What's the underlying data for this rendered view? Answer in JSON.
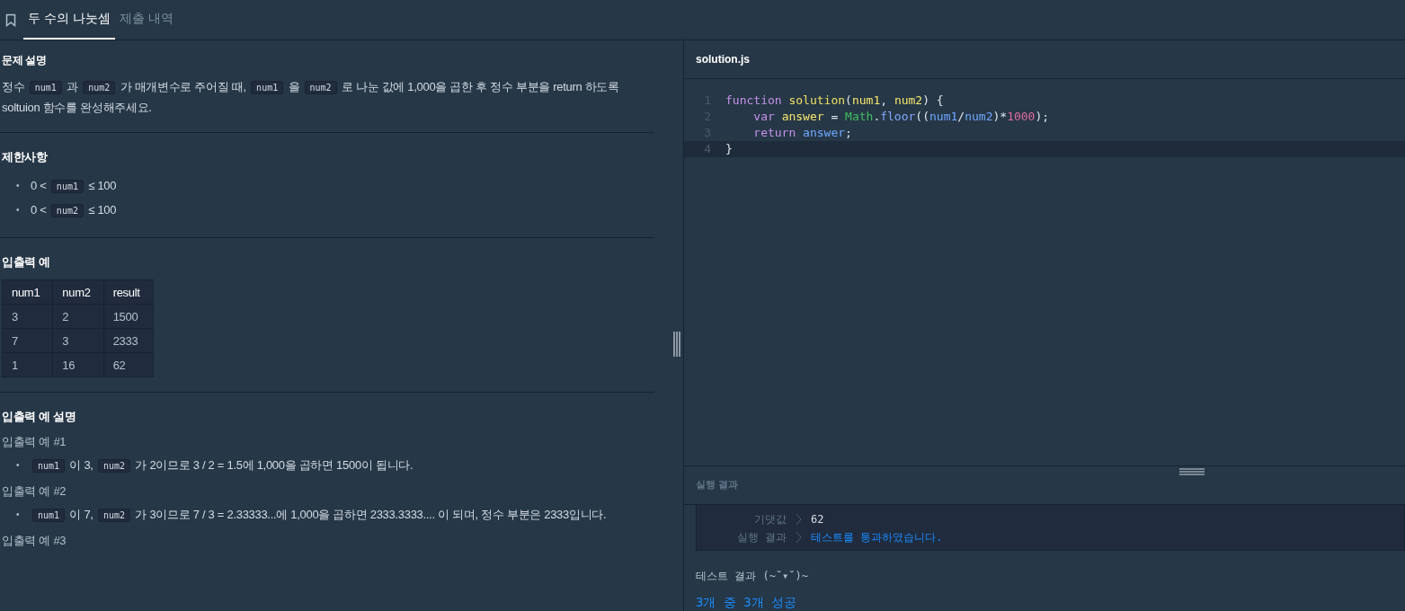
{
  "tabs": [
    {
      "label": "두 수의 나눗셈",
      "selected": true
    },
    {
      "label": "제출 내역",
      "selected": false
    }
  ],
  "description": {
    "title": "문제 설명",
    "paragraph": [
      {
        "kind": "text",
        "text": "정수 "
      },
      {
        "kind": "code",
        "text": "num1"
      },
      {
        "kind": "text",
        "text": " 과 "
      },
      {
        "kind": "code",
        "text": "num2"
      },
      {
        "kind": "text",
        "text": " 가 매개변수로 주어질 때, "
      },
      {
        "kind": "code",
        "text": "num1"
      },
      {
        "kind": "text",
        "text": " 을 "
      },
      {
        "kind": "code",
        "text": "num2"
      },
      {
        "kind": "text",
        "text": " 로 나눈 값에 1,000을 곱한 후 정수 부분을 return 하도록 soltuion 함수를 완성해주세요."
      }
    ]
  },
  "constraints": {
    "title": "제한사항",
    "items": [
      {
        "bullet": "•",
        "segments": [
          {
            "kind": "text",
            "text": "0 < "
          },
          {
            "kind": "code",
            "text": "num1"
          },
          {
            "kind": "text",
            "text": " ≤ 100"
          }
        ]
      },
      {
        "bullet": "•",
        "segments": [
          {
            "kind": "text",
            "text": "0 < "
          },
          {
            "kind": "code",
            "text": "num2"
          },
          {
            "kind": "text",
            "text": " ≤ 100"
          }
        ]
      }
    ]
  },
  "examples": {
    "title": "입출력 예",
    "columns": [
      "num1",
      "num2",
      "result"
    ],
    "rows": [
      [
        "3",
        "2",
        "1500"
      ],
      [
        "7",
        "3",
        "2333"
      ],
      [
        "1",
        "16",
        "62"
      ]
    ]
  },
  "explanation": {
    "title": "입출력 예 설명",
    "groups": [
      {
        "label": "입출력 예 #1",
        "items": [
          {
            "bullet": "•",
            "segments": [
              {
                "kind": "code",
                "text": "num1"
              },
              {
                "kind": "text",
                "text": " 이 3, "
              },
              {
                "kind": "code",
                "text": "num2"
              },
              {
                "kind": "text",
                "text": " 가 2이므로 3 / 2 = 1.5에 1,000을 곱하면 1500이 됩니다."
              }
            ]
          }
        ]
      },
      {
        "label": "입출력 예 #2",
        "items": [
          {
            "bullet": "•",
            "segments": [
              {
                "kind": "code",
                "text": "num1"
              },
              {
                "kind": "text",
                "text": " 이 7, "
              },
              {
                "kind": "code",
                "text": "num2"
              },
              {
                "kind": "text",
                "text": " 가 3이므로 7 / 3 = 2.33333...에 1,000을 곱하면 2333.3333.... 이 되며, 정수 부분은 2333입니다."
              }
            ]
          }
        ]
      },
      {
        "label": "입출력 예 #3"
      }
    ]
  },
  "editor": {
    "filename": "solution.js",
    "lines": [
      {
        "number": "1",
        "active": false,
        "tokens": [
          {
            "kind": "kw",
            "text": "function "
          },
          {
            "kind": "fn",
            "text": "solution"
          },
          {
            "kind": "plain",
            "text": "("
          },
          {
            "kind": "param",
            "text": "num1"
          },
          {
            "kind": "plain",
            "text": ", "
          },
          {
            "kind": "param",
            "text": "num2"
          },
          {
            "kind": "plain",
            "text": ") {"
          }
        ]
      },
      {
        "number": "2",
        "active": false,
        "tokens": [
          {
            "kind": "kw",
            "text": "    var "
          },
          {
            "kind": "param",
            "text": "answer"
          },
          {
            "kind": "plain",
            "text": " = "
          },
          {
            "kind": "builtin",
            "text": "Math"
          },
          {
            "kind": "plain",
            "text": "."
          },
          {
            "kind": "method",
            "text": "floor"
          },
          {
            "kind": "plain",
            "text": "(("
          },
          {
            "kind": "var",
            "text": "num1"
          },
          {
            "kind": "plain",
            "text": "/"
          },
          {
            "kind": "var",
            "text": "num2"
          },
          {
            "kind": "plain",
            "text": ")*"
          },
          {
            "kind": "num",
            "text": "1000"
          },
          {
            "kind": "plain",
            "text": ");"
          }
        ]
      },
      {
        "number": "3",
        "active": false,
        "tokens": [
          {
            "kind": "kw",
            "text": "    return "
          },
          {
            "kind": "var",
            "text": "answer"
          },
          {
            "kind": "plain",
            "text": ";"
          }
        ]
      },
      {
        "number": "4",
        "active": true,
        "tokens": [
          {
            "kind": "plain",
            "text": "}"
          }
        ]
      }
    ]
  },
  "results": {
    "title": "실행 결과",
    "rows": [
      {
        "label": "기댓값",
        "value": "62",
        "kind": "plain"
      },
      {
        "label": "실행 결과",
        "value": "테스트를 통과하였습니다.",
        "kind": "pass"
      }
    ],
    "summary_title": "테스트 결과 (~˘▾˘)~",
    "summary": "3개 중 3개 성공"
  }
}
